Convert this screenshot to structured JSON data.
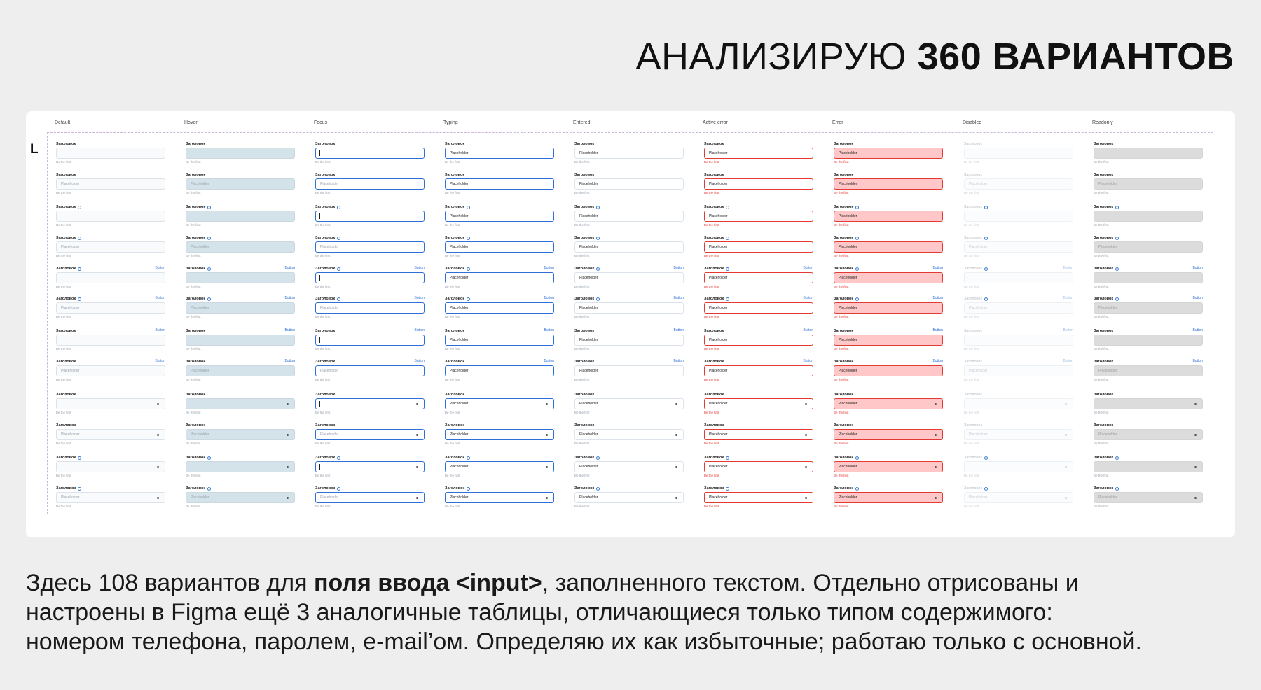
{
  "headline": {
    "thin": "АНАЛИЗИРУЮ",
    "bold": "360 ВАРИАНТОВ"
  },
  "size_label": "L",
  "columns": [
    "Default",
    "Hover",
    "Focus",
    "Typing",
    "Entered",
    "Active error",
    "Error",
    "Disabled",
    "Readonly"
  ],
  "field": {
    "label": "Заголовок",
    "placeholder": "Placeholder",
    "helper": "Be the first",
    "button": "Button"
  },
  "description": {
    "line1_a": "Здесь 108 вариантов для ",
    "line1_bold": "поля ввода <input>",
    "line1_b": ", заполненного текстом. Отдельно отрисованы и",
    "line2": "настроены в Figma ещё 3 аналогичные таблицы, отличающиеся только типом содержимого:",
    "line3": "номером телефона, паролем, e-mail’ом. Определяю их как избыточные; работаю только с основной."
  }
}
